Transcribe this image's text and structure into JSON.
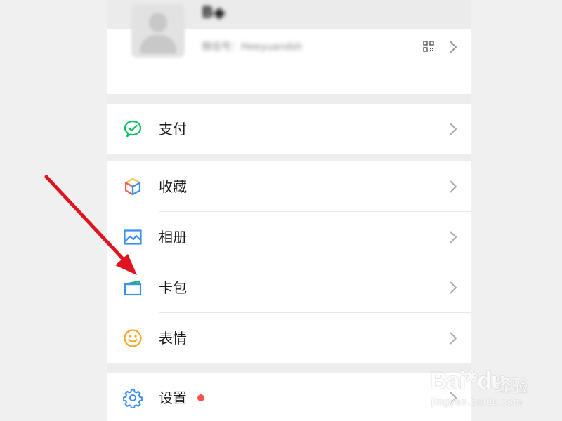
{
  "profile": {
    "nickname": "B◆",
    "wechat_id": "微信号：Heeyuandsh"
  },
  "menu": {
    "pay_label": "支付",
    "favorites_label": "收藏",
    "album_label": "相册",
    "cards_label": "卡包",
    "stickers_label": "表情",
    "settings_label": "设置"
  },
  "colors": {
    "pay": "#07c160",
    "favorites_blue": "#3b8ff0",
    "favorites_yellow": "#f5c342",
    "favorites_red": "#f0605a",
    "album": "#3b8ff0",
    "cards": "#3b8ff0",
    "stickers": "#f5a623",
    "settings": "#3b8ff0",
    "badge": "#fa5151",
    "arrow": "#e0141e"
  },
  "icons": {
    "pay": "wechat-pay-icon",
    "favorites": "cube-icon",
    "album": "image-icon",
    "cards": "wallet-icon",
    "stickers": "smiley-icon",
    "settings": "gear-icon"
  },
  "watermark": {
    "brand": "Bai",
    "brand_suffix": "du",
    "cn": "经验",
    "url": "jingyan.baidu.com"
  }
}
